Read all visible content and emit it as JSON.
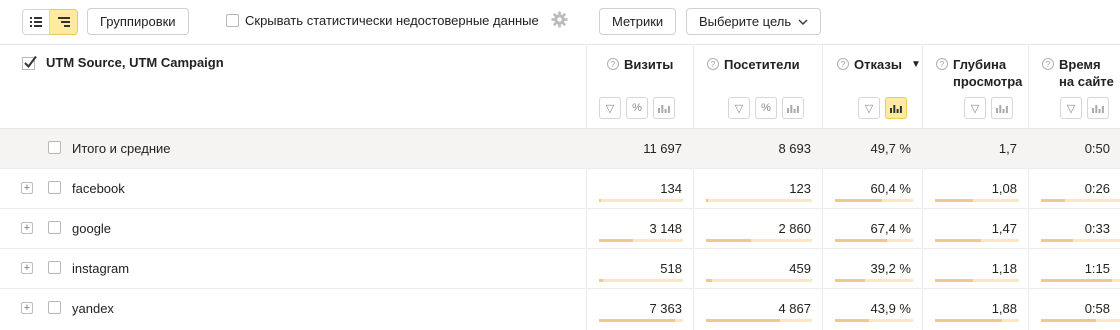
{
  "toolbar": {
    "groupings_label": "Группировки",
    "hide_unreliable_label": "Скрывать статистически недостоверные данные",
    "metrics_label": "Метрики",
    "goal_label": "Выберите цель"
  },
  "table": {
    "dimension_header": "UTM Source, UTM Campaign",
    "columns": [
      {
        "title_line1": "Визиты",
        "title_line2": "",
        "sorted": false
      },
      {
        "title_line1": "Посетители",
        "title_line2": "",
        "sorted": false
      },
      {
        "title_line1": "Отказы",
        "title_line2": "",
        "sorted": true
      },
      {
        "title_line1": "Глубина",
        "title_line2": "просмотра",
        "sorted": false
      },
      {
        "title_line1": "Время",
        "title_line2": "на сайте",
        "sorted": false
      }
    ],
    "totals": {
      "label": "Итого и средние",
      "values": [
        "11 697",
        "8 693",
        "49,7 %",
        "1,7",
        "0:50"
      ]
    },
    "rows": [
      {
        "label": "facebook",
        "values": [
          "134",
          "123",
          "60,4 %",
          "1,08",
          "0:26"
        ],
        "bars": [
          0.011,
          0.014,
          0.6,
          0.45,
          0.31
        ]
      },
      {
        "label": "google",
        "values": [
          "3 148",
          "2 860",
          "67,4 %",
          "1,47",
          "0:33"
        ],
        "bars": [
          0.4,
          0.42,
          0.67,
          0.55,
          0.4
        ]
      },
      {
        "label": "instagram",
        "values": [
          "518",
          "459",
          "39,2 %",
          "1,18",
          "1:15"
        ],
        "bars": [
          0.05,
          0.06,
          0.39,
          0.45,
          0.9
        ]
      },
      {
        "label": "yandex",
        "values": [
          "7 363",
          "4 867",
          "43,9 %",
          "1,88",
          "0:58"
        ],
        "bars": [
          0.9,
          0.7,
          0.44,
          0.8,
          0.7
        ]
      }
    ]
  },
  "colors": {
    "accent": "#ffeba0",
    "bar": "#f0c98a",
    "bar_track": "#fbe6c6",
    "total_bg": "#f5f4f2"
  }
}
